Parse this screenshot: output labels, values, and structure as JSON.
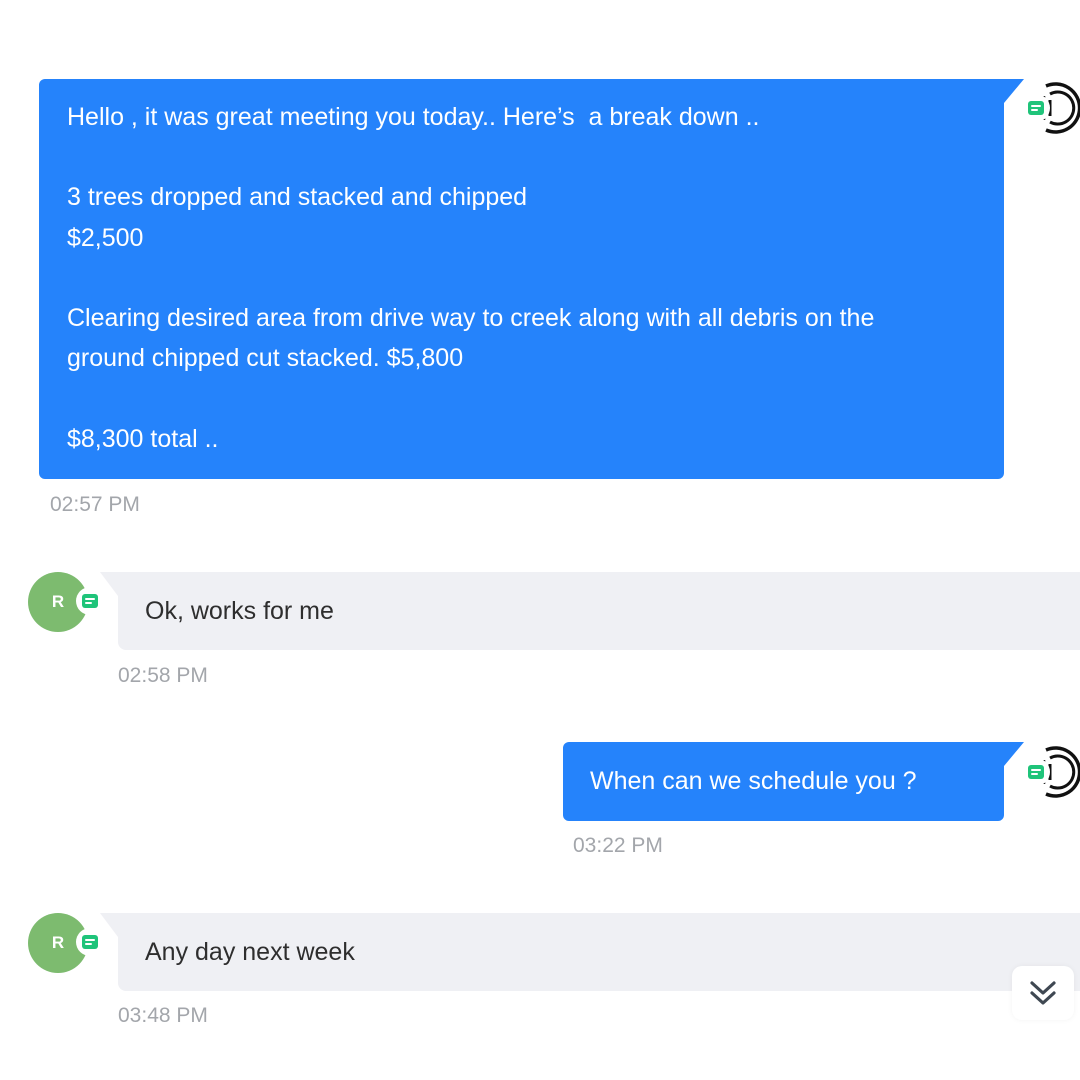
{
  "messages": [
    {
      "direction": "outgoing",
      "lines": [
        "Hello , it was great meeting you today.. Here’s  a break down ..",
        "",
        "3 trees dropped and stacked and chipped",
        "$2,500",
        "",
        "Clearing desired area from drive way to creek along with all debris on the",
        "ground chipped cut stacked. $5,800",
        "",
        "$8,300 total .."
      ],
      "time": "02:57 PM"
    },
    {
      "direction": "incoming",
      "avatar_initial": "R",
      "text": "Ok, works for me",
      "time": "02:58 PM"
    },
    {
      "direction": "outgoing",
      "text": "When can we schedule you ?",
      "time": "03:22 PM"
    },
    {
      "direction": "incoming",
      "avatar_initial": "R",
      "text": "Any day next week",
      "time": "03:48 PM"
    }
  ],
  "icons": {
    "channel": "sms-icon",
    "agent_avatar": "agent-avatar-icon",
    "scroll": "double-chevron-down-icon"
  },
  "colors": {
    "outgoing_bubble": "#2583fb",
    "incoming_bubble": "#eff0f4",
    "contact_avatar": "#7dbb6f",
    "channel_badge": "#1fc47a",
    "timestamp": "#a3a6ab"
  }
}
